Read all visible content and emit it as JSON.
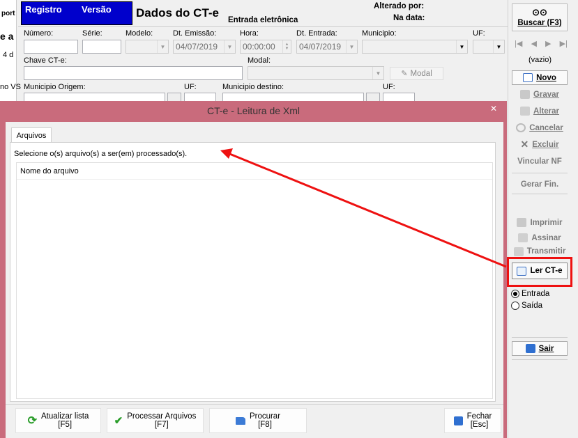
{
  "left_strip": {
    "t1": "port",
    "t2": "e a",
    "t3": "4 d",
    "t4": "no VS"
  },
  "header": {
    "registro": "Registro",
    "versao": "Versão",
    "title": "Dados do CT-e",
    "subtitle": "Entrada eletrônica",
    "alterado_por": "Alterado por:",
    "na_data": "Na data:"
  },
  "form": {
    "numero": "Número:",
    "serie": "Série:",
    "modelo": "Modelo:",
    "dt_emissao": "Dt. Emissão:",
    "dt_emissao_value": "04/07/2019",
    "hora": "Hora:",
    "hora_value": "00:00:00",
    "dt_entrada": "Dt. Entrada:",
    "dt_entrada_value": "04/07/2019",
    "municipio": "Municipio:",
    "uf": "UF:",
    "chave": "Chave CT-e:",
    "modal": "Modal:",
    "modal_button": "Modal",
    "municipio_origem": "Municipio Origem:",
    "uf2": "UF:",
    "municipio_destino": "Municipio destino:",
    "uf3": "UF:"
  },
  "sidebar": {
    "buscar": "Buscar (F3)",
    "vazio": "(vazio)",
    "novo": "Novo",
    "gravar": "Gravar",
    "alterar": "Alterar",
    "cancelar": "Cancelar",
    "excluir": "Excluir",
    "vincular": "Vincular NF",
    "gerar": "Gerar Fin.",
    "imprimir": "Imprimir",
    "assinar": "Assinar",
    "transmitir": "Transmitir",
    "ler": "Ler CT-e",
    "entrada": "Entrada",
    "saida": "Saída",
    "sair": "Sair"
  },
  "dialog": {
    "title": "CT-e - Leitura de Xml",
    "close": "✕",
    "tab": "Arquivos",
    "instruction": "Selecione o(s) arquivo(s) a ser(em) processado(s).",
    "column": "Nome do arquivo",
    "buttons": {
      "atualizar": "Atualizar lista",
      "atualizar_key": "[F5]",
      "processar": "Processar Arquivos",
      "processar_key": "[F7]",
      "procurar": "Procurar",
      "procurar_key": "[F8]",
      "fechar": "Fechar",
      "fechar_key": "[Esc]"
    }
  },
  "colors": {
    "accent_blue": "#0000cc",
    "dialog_frame": "#c96b7c",
    "highlight_red": "#ee1111"
  }
}
